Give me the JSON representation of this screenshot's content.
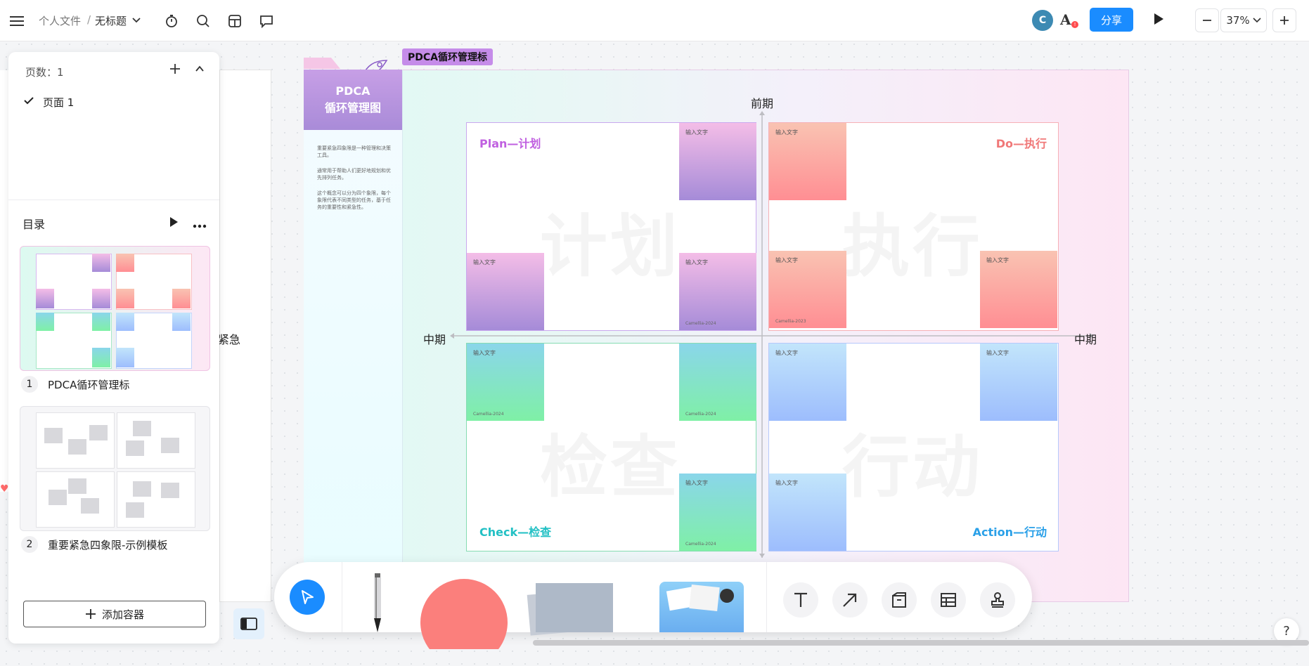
{
  "topbar": {
    "breadcrumb_parent": "个人文件",
    "breadcrumb_sep": "/",
    "breadcrumb_current": "无标题",
    "avatar_letter": "C",
    "share_label": "分享",
    "zoom_value": "37%",
    "colors": {
      "share_bg": "#1a8cff",
      "avatar_bg": "#3d8ab3"
    }
  },
  "sidebar": {
    "pages_label": "页数：1",
    "page_item": "页面 1",
    "toc_label": "目录",
    "items": [
      {
        "num": "1",
        "label": "PDCA循环管理标"
      },
      {
        "num": "2",
        "label": "重要紧急四象限-示例模板"
      }
    ],
    "add_container_label": "添加容器"
  },
  "canvas": {
    "frame_label": "PDCA循环管理标",
    "header_line1": "PDCA",
    "header_line2": "循环管理图",
    "desc1": "重要紧急四象限是一种管理和决策工具。",
    "desc2": "通常用于帮助人们更好地规划和优先排列任务。",
    "desc3": "这个概念可以分为四个象限，每个象限代表不同类型的任务，基于任务的重要性和紧急性。",
    "axis_top": "前期",
    "axis_left": "中期",
    "axis_right": "中期",
    "left_edge_text": "紧急",
    "quadrants": {
      "plan": {
        "title": "Plan—计划",
        "watermark": "计划",
        "color": "#c060e0"
      },
      "do": {
        "title": "Do—执行",
        "watermark": "执行",
        "color": "#f07878"
      },
      "check": {
        "title": "Check—检查",
        "watermark": "检查",
        "color": "#22c0c4"
      },
      "action": {
        "title": "Action—行动",
        "watermark": "行动",
        "color": "#2aa0e8"
      }
    },
    "note_text": "输入文字",
    "note_sig": "Camellia-2024",
    "note_sig2": "Camellia-2023"
  }
}
